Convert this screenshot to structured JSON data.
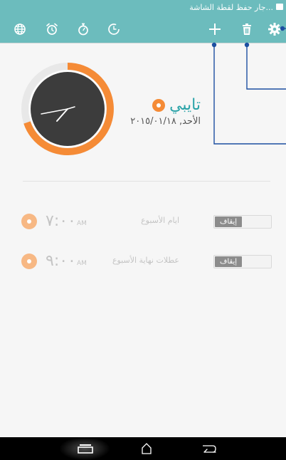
{
  "statusbar": {
    "text": "جار حفظ لقطة الشاشة..."
  },
  "toolbar": {
    "tabs": [
      {
        "icon": "globe-icon",
        "name": "world-clock"
      },
      {
        "icon": "alarm-clock-icon",
        "name": "alarm"
      },
      {
        "icon": "stopwatch-icon",
        "name": "stopwatch"
      },
      {
        "icon": "timer-icon",
        "name": "timer"
      }
    ],
    "actions": [
      {
        "icon": "plus-icon",
        "name": "add"
      },
      {
        "icon": "trash-icon",
        "name": "delete"
      },
      {
        "icon": "gear-icon",
        "name": "settings"
      }
    ]
  },
  "clock": {
    "city": "تايبي",
    "date": "الأحد, ٢٠١٥/٠١/١٨",
    "ring_color": "#f58b36",
    "face_color": "#3c3c3c"
  },
  "alarms": [
    {
      "time": "٧:٠٠",
      "ampm": "AM",
      "label": "ايام الأسبوع",
      "toggle": "إيقاف"
    },
    {
      "time": "٩:٠٠",
      "ampm": "AM",
      "label": "عطلات نهاية الأسبوع",
      "toggle": "إيقاف"
    }
  ],
  "navbar": {
    "buttons": [
      "recent-apps-icon",
      "home-icon",
      "back-icon"
    ]
  },
  "colors": {
    "accent": "#6cbcbd",
    "city": "#2aa3a8",
    "orange": "#f58b36",
    "callout": "#1c4fa0"
  }
}
